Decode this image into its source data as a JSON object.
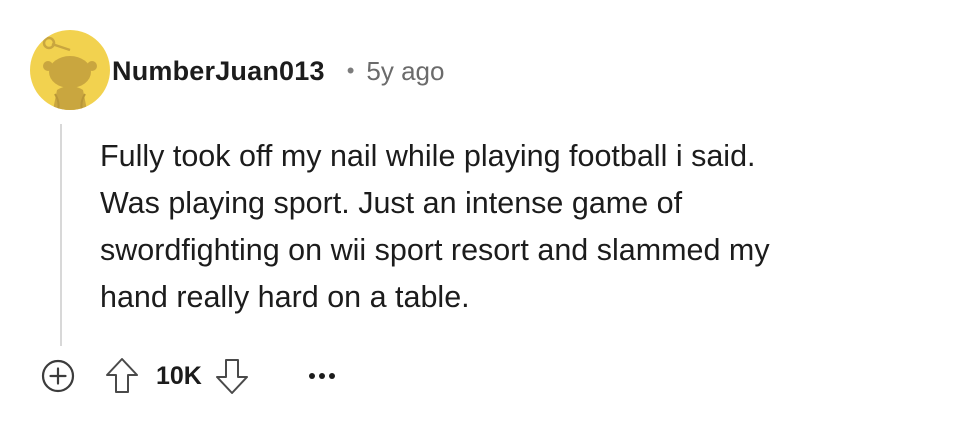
{
  "comment": {
    "author": "NumberJuan013",
    "separator": "•",
    "timestamp": "5y ago",
    "body_lines": [
      "Fully took off my nail while playing football i said.",
      "Was playing sport. Just an intense game of",
      "swordfighting on wii sport resort and slammed my",
      "hand really hard on a table."
    ],
    "score": "10K"
  },
  "colors": {
    "avatar_bg": "#f2d24f",
    "avatar_figure": "#cfae45",
    "thread_line": "#d8d8d8",
    "icon_stroke": "#4a4a4a"
  },
  "icons": {
    "avatar": "snoo-avatar-icon",
    "expand": "plus-circle-icon",
    "upvote": "upvote-arrow-icon",
    "downvote": "downvote-arrow-icon",
    "more": "ellipsis-icon"
  }
}
